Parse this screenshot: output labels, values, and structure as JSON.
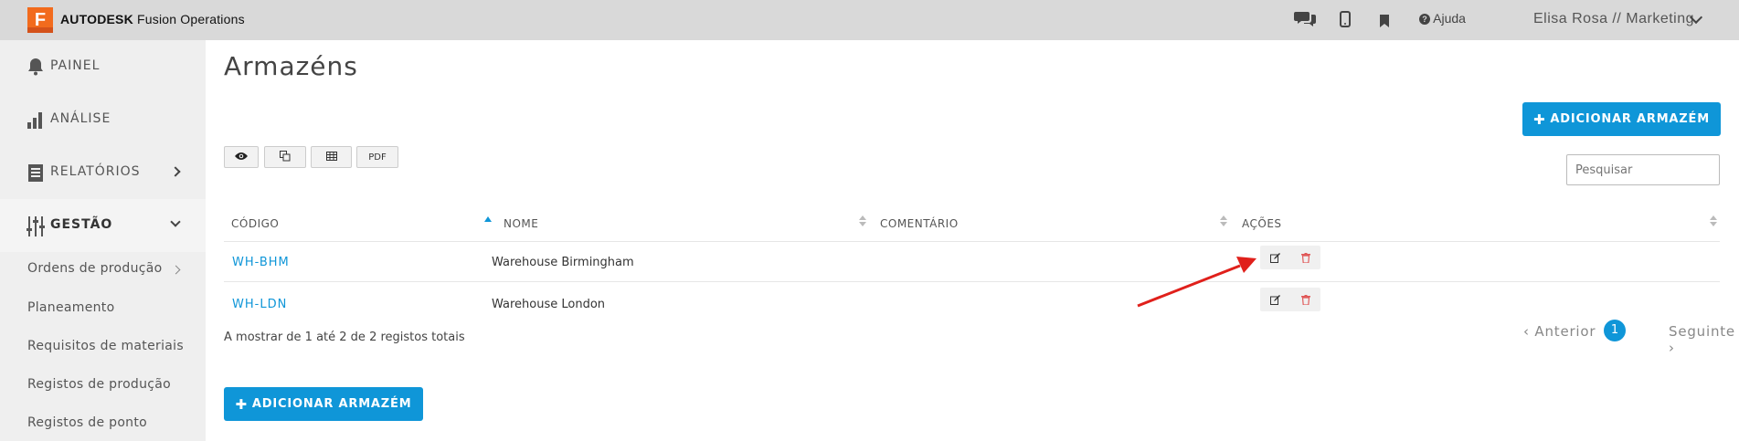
{
  "header": {
    "logo_letter": "F",
    "brand_bold": "AUTODESK",
    "brand_rest": "Fusion Operations",
    "help_label": "Ajuda",
    "user_label": "Elisa Rosa // Marketing",
    "icons": [
      "chat-icon",
      "mobile-icon",
      "bookmark-icon",
      "help-icon"
    ]
  },
  "sidebar": {
    "items": [
      {
        "label": "PAINEL",
        "icon": "bell-icon"
      },
      {
        "label": "ANÁLISE",
        "icon": "bar-chart-icon"
      },
      {
        "label": "RELATÓRIOS",
        "icon": "document-icon"
      },
      {
        "label": "GESTÃO",
        "icon": "sliders-icon"
      }
    ],
    "subitems": [
      {
        "label": "Ordens de produção"
      },
      {
        "label": "Planeamento"
      },
      {
        "label": "Requisitos de materiais"
      },
      {
        "label": "Registos de produção"
      },
      {
        "label": "Registos de ponto"
      }
    ]
  },
  "page": {
    "title": "Armazéns",
    "add_button_label": "ADICIONAR ARMAZÉM",
    "search_placeholder": "Pesquisar",
    "toolbar": {
      "pdf_label": "PDF"
    }
  },
  "table": {
    "headers": [
      "CÓDIGO",
      "NOME",
      "COMENTÁRIO",
      "AÇÕES"
    ],
    "rows": [
      {
        "code": "WH-BHM",
        "name": "Warehouse Birmingham",
        "comment": ""
      },
      {
        "code": "WH-LDN",
        "name": "Warehouse London",
        "comment": ""
      }
    ]
  },
  "footer": {
    "info": "A mostrar de 1 até 2 de 2 registos totais",
    "prev_label": "Anterior",
    "page_number": "1",
    "next_label": "Seguinte"
  },
  "colors": {
    "accent": "#0f96d8",
    "topbar": "#d9d9d9",
    "sidebar": "#efefef",
    "logo": "#f26b1d",
    "delete": "#e05a5a",
    "annotation_arrow": "#e0201b"
  }
}
